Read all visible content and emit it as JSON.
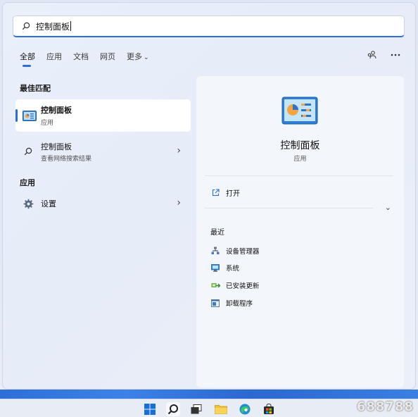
{
  "search": {
    "query": "控制面板"
  },
  "tabs": [
    {
      "label": "全部",
      "active": true
    },
    {
      "label": "应用"
    },
    {
      "label": "文档"
    },
    {
      "label": "网页"
    },
    {
      "label": "更多"
    }
  ],
  "sections": {
    "best_match_title": "最佳匹配",
    "apps_title": "应用"
  },
  "best_match": {
    "title": "控制面板",
    "subtitle": "应用",
    "icon": "control-panel-icon"
  },
  "web_result": {
    "title": "控制面板",
    "subtitle": "查看网络搜索结果",
    "icon": "search-icon"
  },
  "apps": [
    {
      "title": "设置",
      "icon": "settings-gear-icon"
    }
  ],
  "detail": {
    "name": "控制面板",
    "type": "应用",
    "open_label": "打开",
    "recent_title": "最近",
    "recent": [
      {
        "label": "设备管理器",
        "icon": "device-manager-icon"
      },
      {
        "label": "系统",
        "icon": "system-icon"
      },
      {
        "label": "已安装更新",
        "icon": "installed-updates-icon"
      },
      {
        "label": "卸载程序",
        "icon": "uninstall-program-icon"
      }
    ]
  },
  "watermark": "688788",
  "colors": {
    "accent": "#2b6fd6",
    "panel": "#eaf0fa",
    "detail": "#f3f6fb"
  }
}
